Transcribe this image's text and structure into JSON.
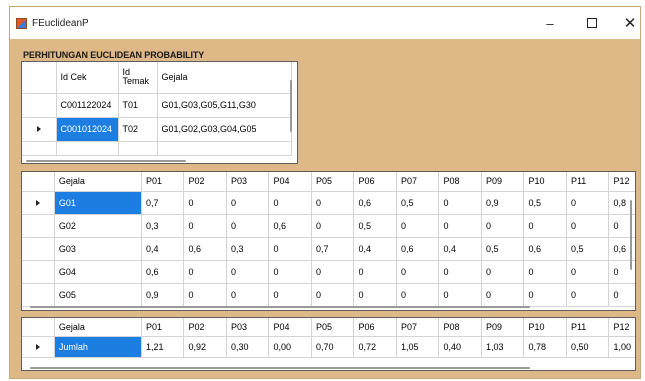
{
  "window": {
    "title": "FEuclideanP"
  },
  "heading": "PERHITUNGAN EUCLIDEAN PROBABILITY",
  "grid1": {
    "headers": [
      "Id Cek",
      "Id Temak",
      "Gejala"
    ],
    "rows": [
      [
        "C001122024",
        "T01",
        "G01,G03,G05,G11,G30"
      ],
      [
        "C001012024",
        "T02",
        "G01,G02,G03,G04,G05"
      ]
    ]
  },
  "grid2": {
    "headers": [
      "Gejala",
      "P01",
      "P02",
      "P03",
      "P04",
      "P05",
      "P06",
      "P07",
      "P08",
      "P09",
      "P10",
      "P11",
      "P12"
    ],
    "rows": [
      [
        "G01",
        "0,7",
        "0",
        "0",
        "0",
        "0",
        "0,6",
        "0,5",
        "0",
        "0,9",
        "0,5",
        "0",
        "0,8"
      ],
      [
        "G02",
        "0,3",
        "0",
        "0",
        "0,6",
        "0",
        "0,5",
        "0",
        "0",
        "0",
        "0",
        "0",
        "0"
      ],
      [
        "G03",
        "0,4",
        "0,6",
        "0,3",
        "0",
        "0,7",
        "0,4",
        "0,6",
        "0,4",
        "0,5",
        "0,6",
        "0,5",
        "0,6"
      ],
      [
        "G04",
        "0,6",
        "0",
        "0",
        "0",
        "0",
        "0",
        "0",
        "0",
        "0",
        "0",
        "0",
        "0"
      ],
      [
        "G05",
        "0,9",
        "0",
        "0",
        "0",
        "0",
        "0",
        "0",
        "0",
        "0",
        "0",
        "0",
        "0"
      ]
    ]
  },
  "grid3": {
    "headers": [
      "Gejala",
      "P01",
      "P02",
      "P03",
      "P04",
      "P05",
      "P06",
      "P07",
      "P08",
      "P09",
      "P10",
      "P11",
      "P12"
    ],
    "rows": [
      [
        "Jumlah",
        "1,21",
        "0,92",
        "0,30",
        "0,00",
        "0,70",
        "0,72",
        "1,05",
        "0,40",
        "1,03",
        "0,78",
        "0,50",
        "1,00"
      ]
    ]
  }
}
